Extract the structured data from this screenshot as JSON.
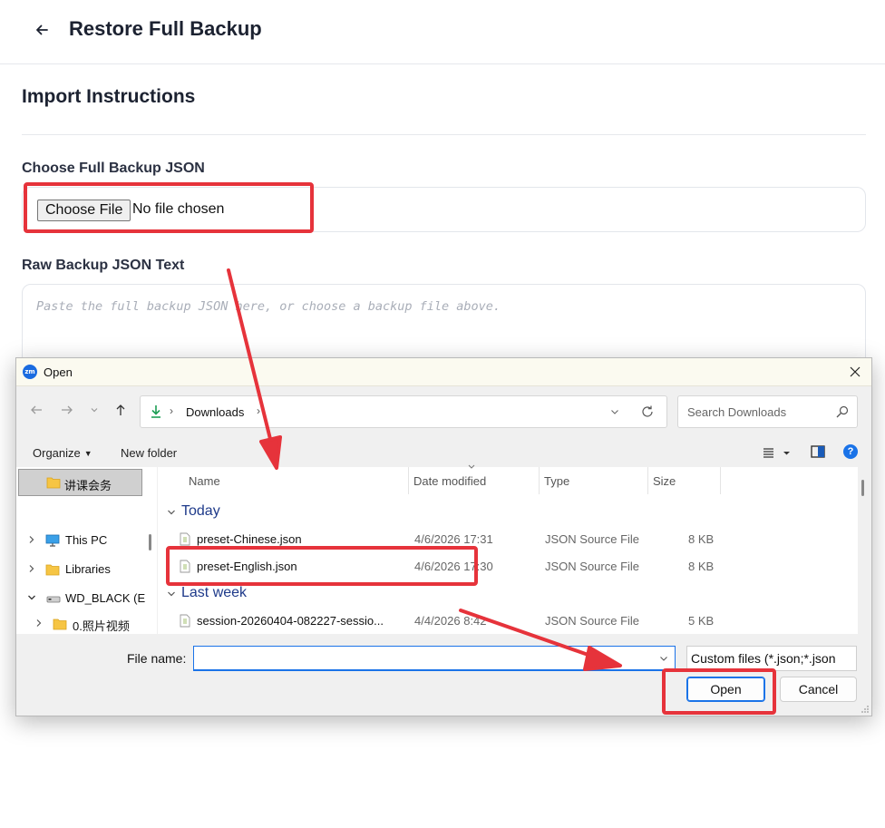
{
  "page": {
    "title": "Restore Full Backup",
    "section_title": "Import Instructions",
    "choose_label": "Choose Full Backup JSON",
    "choose_button": "Choose File",
    "no_file_text": "No file chosen",
    "raw_label": "Raw Backup JSON Text",
    "raw_placeholder": "Paste the full backup JSON here, or choose a backup file above."
  },
  "dialog": {
    "app_icon_text": "zm",
    "title": "Open",
    "address": {
      "path": "Downloads"
    },
    "search_placeholder": "Search Downloads",
    "toolbar": {
      "organize": "Organize",
      "new_folder": "New folder"
    },
    "nav_items": [
      {
        "label": "讲课会务"
      },
      {
        "label": "This PC"
      },
      {
        "label": "Libraries"
      },
      {
        "label": "WD_BLACK (E"
      },
      {
        "label": "0.照片视频"
      }
    ],
    "columns": {
      "name": "Name",
      "date": "Date modified",
      "type": "Type",
      "size": "Size"
    },
    "groups": [
      {
        "label": "Today",
        "files": [
          {
            "name": "preset-Chinese.json",
            "date": "4/6/2026 17:31",
            "type": "JSON Source File",
            "size": "8 KB"
          },
          {
            "name": "preset-English.json",
            "date": "4/6/2026 17:30",
            "type": "JSON Source File",
            "size": "8 KB"
          }
        ]
      },
      {
        "label": "Last week",
        "files": [
          {
            "name": "session-20260404-082227-sessio...",
            "date": "4/4/2026 8:42",
            "type": "JSON Source File",
            "size": "5 KB"
          }
        ]
      }
    ],
    "file_name_label": "File name:",
    "file_name_value": "",
    "filter": "Custom files (*.json;*.json",
    "open_button": "Open",
    "cancel_button": "Cancel"
  },
  "colors": {
    "annotation": "#e6333b",
    "accent": "#1a73e8",
    "group_heading": "#1e3a8a",
    "dialog_bg": "#f0f0f0"
  }
}
